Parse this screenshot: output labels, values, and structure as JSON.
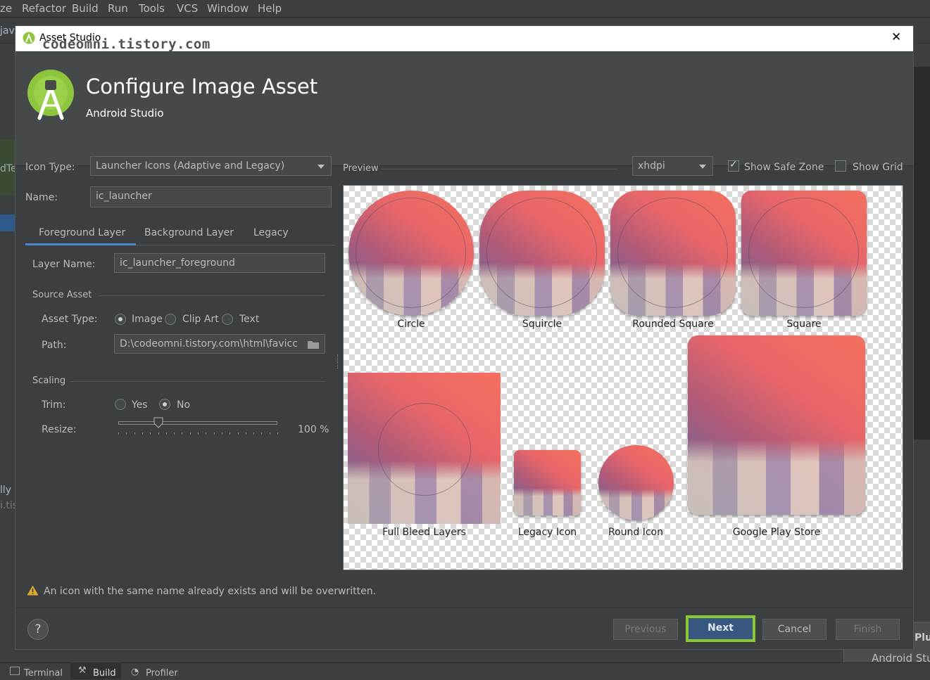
{
  "menu": [
    "ze",
    "Refactor",
    "Build",
    "Run",
    "Tools",
    "VCS",
    "Window",
    "Help"
  ],
  "ide": {
    "left_fragments": [
      "jav",
      "dTe",
      "lly",
      "i.tis"
    ],
    "bottom_tabs": [
      "Terminal",
      "Build",
      "Profiler"
    ],
    "notification": {
      "title": "Plu",
      "text": "Android Stu"
    }
  },
  "dialog": {
    "window_title": "Asset Studio",
    "watermark": "codeomni.tistory.com",
    "close_glyph": "✕",
    "header_title": "Configure Image Asset",
    "header_subtitle": "Android Studio",
    "icon_type_label": "Icon Type:",
    "icon_type_value": "Launcher Icons (Adaptive and Legacy)",
    "name_label": "Name:",
    "name_value": "ic_launcher",
    "tabs": [
      "Foreground Layer",
      "Background Layer",
      "Legacy"
    ],
    "active_tab": 0,
    "layer_name_label": "Layer Name:",
    "layer_name_value": "ic_launcher_foreground",
    "source_asset_label": "Source Asset",
    "asset_type_label": "Asset Type:",
    "asset_types": [
      "Image",
      "Clip Art",
      "Text"
    ],
    "asset_type_selected": "Image",
    "path_label": "Path:",
    "path_value": "D:\\codeomni.tistory.com\\html\\favicc",
    "scaling_label": "Scaling",
    "trim_label": "Trim:",
    "trim_options": [
      "Yes",
      "No"
    ],
    "trim_selected": "No",
    "resize_label": "Resize:",
    "resize_value_text": "100 %",
    "resize_percent": 25,
    "preview_label": "Preview",
    "density_value": "xhdpi",
    "show_safe_zone_label": "Show Safe Zone",
    "show_safe_zone_checked": true,
    "show_grid_label": "Show Grid",
    "show_grid_checked": false,
    "preview_captions": {
      "circle": "Circle",
      "squircle": "Squircle",
      "rounded_square": "Rounded Square",
      "square": "Square",
      "full_bleed": "Full Bleed Layers",
      "legacy": "Legacy Icon",
      "round": "Round Icon",
      "play_store": "Google Play Store"
    },
    "warning_text": "An icon with the same name already exists and will be overwritten.",
    "help_glyph": "?",
    "buttons": {
      "previous": "Previous",
      "next": "Next",
      "cancel": "Cancel",
      "finish": "Finish"
    },
    "colors": {
      "next_highlight": "#8ac832",
      "next_fill": "#365880",
      "android_green": "#8ec53f"
    }
  }
}
